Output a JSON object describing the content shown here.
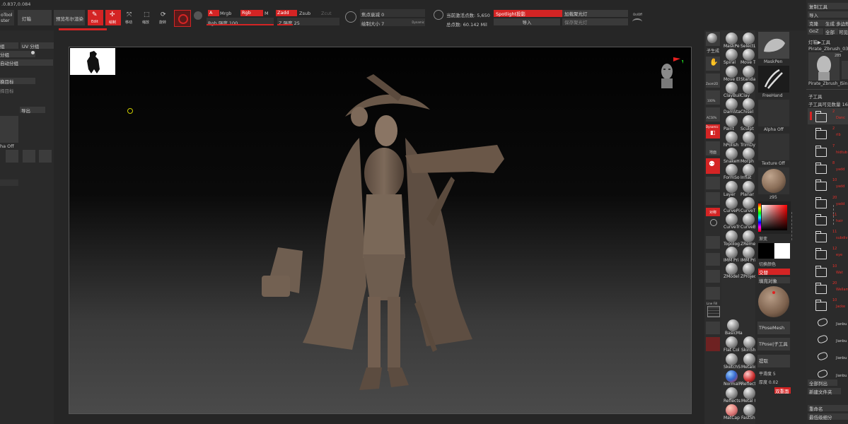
{
  "topbar": {
    "coords": ".0.837,0.084",
    "menu_light": "灯箱",
    "preview_render": "预览布尔渲染",
    "tool_name_line1": "oTool",
    "tool_name_line2": "ster",
    "edit_label": "Edit",
    "draw_label": "绘制",
    "move_label": "移动",
    "scale_label": "缩放",
    "rotate_label": "旋转",
    "mode_a": "A",
    "mode_mrgb": "Mrgb",
    "mode_rgb": "Rgb",
    "mode_m": "M",
    "zadd": "Zadd",
    "zsub": "Zsub",
    "zcut": "Zcut",
    "rgb_intensity": "Rgb 强度 100",
    "z_intensity": "Z 强度 25",
    "focal_shift": "焦点衰减 0",
    "draw_size": "绘制大小 7",
    "dynamic": "Dynamic",
    "active_points": "当前激活点数: 5,650",
    "total_points": "总点数: 60.142 Mil",
    "spotlight": "Spotlight投影",
    "load_spotlight": "加载聚光灯",
    "import": "导入",
    "save_spotlight": "保存聚光灯",
    "onoff": "On/Off"
  },
  "left_panel": {
    "row1a": "组",
    "row1b": "UV 分组",
    "row2": "分组",
    "row3": "自动分组",
    "row4": "换目标",
    "row5": "择目标",
    "row6": "导出",
    "alpha_off": "ha Off"
  },
  "right_panel": {
    "copy_tool": "复制工具",
    "import": "导入",
    "clone": "克隆",
    "make_polymesh": "生成 多边形网",
    "goz": "GoZ",
    "all": "全部",
    "visible": "可见",
    "r": "R",
    "light_box_tool": "灯箱▶工具",
    "tool_name": "Pirate_Zbrush_03",
    "thumb_count": "285",
    "thumb_label": "Pirate_Zbrush_(",
    "thumb_label2": "Sin",
    "subtool": "子工具",
    "subtool_visible": "子工具可见数量 16",
    "subtool_items": [
      {
        "num": "2",
        "name": "Danc"
      },
      {
        "num": "2",
        "name": "rib"
      },
      {
        "num": "7",
        "name": "hidtub"
      },
      {
        "num": "8",
        "name": "yadd"
      },
      {
        "num": "10",
        "name": "yadd"
      },
      {
        "num": "20",
        "name": "yadd"
      },
      {
        "num": "11",
        "name": "hair"
      },
      {
        "num": "11",
        "name": "subdiv"
      },
      {
        "num": "12",
        "name": "eye"
      },
      {
        "num": "10",
        "name": "Wat"
      },
      {
        "num": "20",
        "name": "Wellam"
      },
      {
        "num": "10",
        "name": "Jacke"
      },
      {
        "num": "",
        "name": "Jianbu"
      },
      {
        "num": "",
        "name": "Jianbu"
      },
      {
        "num": "",
        "name": "Jianbu"
      },
      {
        "num": "",
        "name": "Jianbu"
      }
    ],
    "list_all": "全部列出",
    "new_folder": "新建文件夹",
    "rename": "重命名",
    "lowest_subdiv": "最低级细分"
  },
  "brush_palette": {
    "brushes": [
      {
        "name": "MaskPe"
      },
      {
        "name": "SelectL"
      },
      {
        "name": "Spiral"
      },
      {
        "name": "Move To"
      },
      {
        "name": "Move El"
      },
      {
        "name": "Standar"
      },
      {
        "name": "ClayBuil"
      },
      {
        "name": "Clay"
      },
      {
        "name": "DamSta"
      },
      {
        "name": "Chisel"
      },
      {
        "name": "Paint"
      },
      {
        "name": "Sculpt"
      },
      {
        "name": "hPolish"
      },
      {
        "name": "TrimDyr"
      },
      {
        "name": "SnakeH"
      },
      {
        "name": "Morph"
      },
      {
        "name": "FormSo"
      },
      {
        "name": "Inflat"
      },
      {
        "name": "Layer"
      },
      {
        "name": "Planar"
      },
      {
        "name": "CurvePi"
      },
      {
        "name": "CurveTu"
      },
      {
        "name": "CurveTr"
      },
      {
        "name": "CurveBr"
      },
      {
        "name": "Topolog"
      },
      {
        "name": "ZReme"
      },
      {
        "name": "IMM Pri"
      },
      {
        "name": "IMM Pri"
      },
      {
        "name": "ZModel"
      },
      {
        "name": "ZProjec"
      }
    ],
    "materials": [
      {
        "name": "BasicMa"
      },
      {
        "name": "Flat Col"
      },
      {
        "name": "SkinSha"
      },
      {
        "name": "SketchS"
      },
      {
        "name": "MetalicE"
      },
      {
        "name": "NormalR"
      },
      {
        "name": "ReflectF"
      },
      {
        "name": "Reflects"
      },
      {
        "name": "Metal 0"
      },
      {
        "name": "MatCap"
      },
      {
        "name": "FastSha"
      }
    ],
    "maskpen": "MaskPen",
    "freehand": "FreeHand",
    "alpha_off": "Alpha Off",
    "texture_off": "Texture Off",
    "material_name": "z95",
    "gradient": "渐变",
    "switch_color": "切换颜色",
    "alternate": "交替",
    "fill_object": "填充对象",
    "tpose_mesh": "TPoseMesh",
    "tpose_subtool": "TPose|子工具",
    "extract": "提取",
    "smooth": "平滑度 5",
    "thickness": "厚度 0.02",
    "double_sided": "双重面",
    "label_subtool": "子生成",
    "colors": {
      "accent": "#d42424",
      "bg": "#2a2a2a"
    }
  },
  "left_tools": {
    "scroll": "滚动",
    "zoom": "缩放",
    "zoom2d": "Zoom2D",
    "pct100": "100%",
    "ac50": "AC50%",
    "dynamic": "Dynamic",
    "perspective": "透视",
    "floor": "地面",
    "local": "局部",
    "sym": "对称",
    "lsym": "L.Sym",
    "rotate": "旋转",
    "frame": "外框",
    "move": "移动",
    "zoom3d": "缩放",
    "rotate3d": "旋转",
    "linefill": "Line Fill",
    "polyf": "PolyF",
    "transp": "透明",
    "solo": "单独"
  }
}
